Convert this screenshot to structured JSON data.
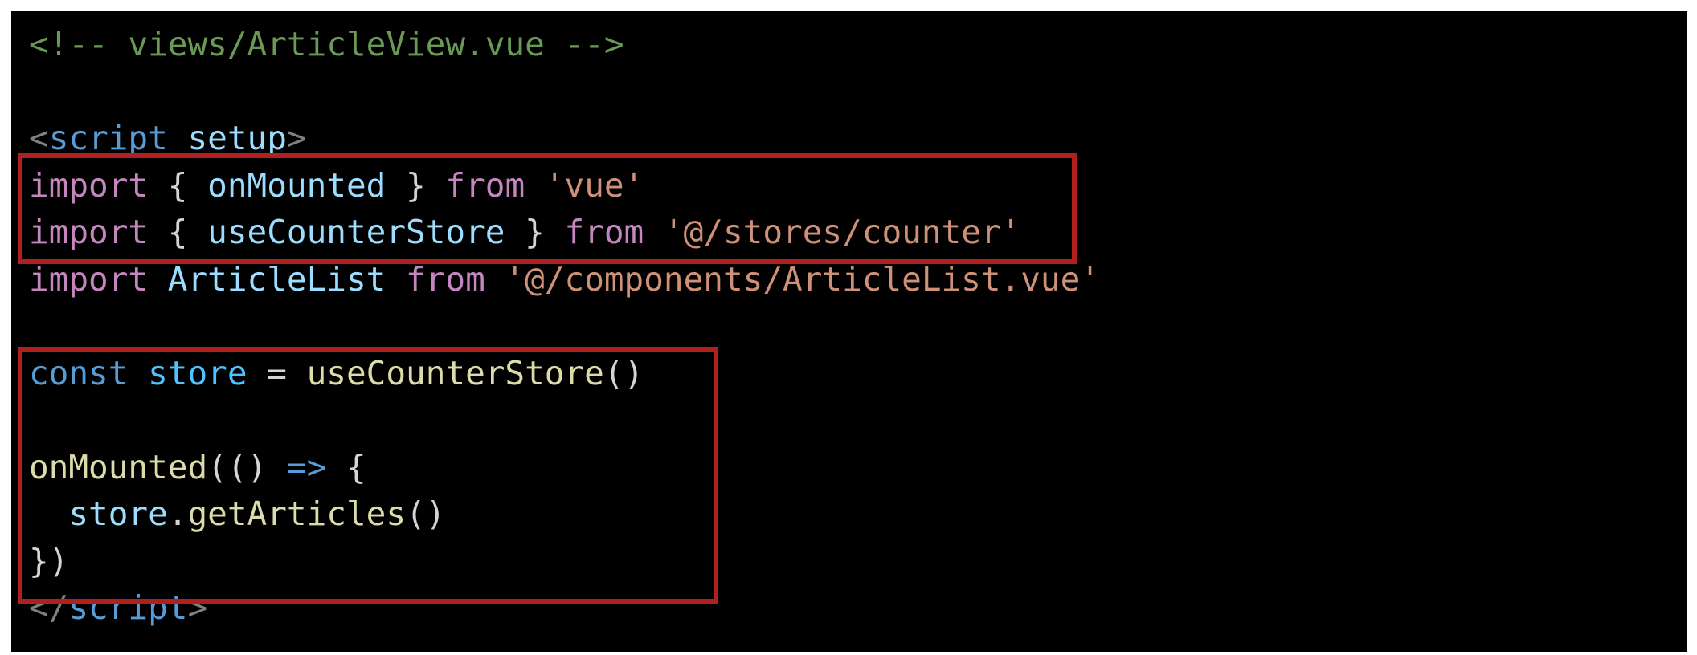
{
  "colors": {
    "background": "#000000",
    "page_border": "#ffffff",
    "highlight_box": "#b11f1f",
    "comment": "#6a9955",
    "keyword": "#c586c0",
    "string": "#ce9178",
    "function": "#dcdcaa",
    "variable": "#9cdcfe",
    "storage": "#569cd6",
    "constant": "#4fc1ff"
  },
  "code": {
    "lines": [
      [
        {
          "t": "<!-- views/ArticleView.vue -->",
          "c": "comment"
        }
      ],
      [],
      [
        {
          "t": "<",
          "c": "tag"
        },
        {
          "t": "script",
          "c": "tagname"
        },
        {
          "t": " ",
          "c": "punct"
        },
        {
          "t": "setup",
          "c": "attr"
        },
        {
          "t": ">",
          "c": "tag"
        }
      ],
      [
        {
          "t": "import",
          "c": "keyword"
        },
        {
          "t": " { ",
          "c": "punct"
        },
        {
          "t": "onMounted",
          "c": "var"
        },
        {
          "t": " } ",
          "c": "punct"
        },
        {
          "t": "from",
          "c": "keyword"
        },
        {
          "t": " ",
          "c": "punct"
        },
        {
          "t": "'vue'",
          "c": "string"
        }
      ],
      [
        {
          "t": "import",
          "c": "keyword"
        },
        {
          "t": " { ",
          "c": "punct"
        },
        {
          "t": "useCounterStore",
          "c": "var"
        },
        {
          "t": " } ",
          "c": "punct"
        },
        {
          "t": "from",
          "c": "keyword"
        },
        {
          "t": " ",
          "c": "punct"
        },
        {
          "t": "'@/stores/counter'",
          "c": "string"
        }
      ],
      [
        {
          "t": "import",
          "c": "keyword"
        },
        {
          "t": " ",
          "c": "punct"
        },
        {
          "t": "ArticleList",
          "c": "var"
        },
        {
          "t": " ",
          "c": "punct"
        },
        {
          "t": "from",
          "c": "keyword"
        },
        {
          "t": " ",
          "c": "punct"
        },
        {
          "t": "'@/components/ArticleList.vue'",
          "c": "string"
        }
      ],
      [],
      [
        {
          "t": "const",
          "c": "storage"
        },
        {
          "t": " ",
          "c": "punct"
        },
        {
          "t": "store",
          "c": "const"
        },
        {
          "t": " = ",
          "c": "op"
        },
        {
          "t": "useCounterStore",
          "c": "fn"
        },
        {
          "t": "()",
          "c": "punct"
        }
      ],
      [],
      [
        {
          "t": "onMounted",
          "c": "fn"
        },
        {
          "t": "(() ",
          "c": "punct"
        },
        {
          "t": "=>",
          "c": "arrow"
        },
        {
          "t": " {",
          "c": "punct"
        }
      ],
      [
        {
          "t": "  ",
          "c": "punct"
        },
        {
          "t": "store",
          "c": "var"
        },
        {
          "t": ".",
          "c": "punct"
        },
        {
          "t": "getArticles",
          "c": "fn"
        },
        {
          "t": "()",
          "c": "punct"
        }
      ],
      [
        {
          "t": "})",
          "c": "punct"
        }
      ],
      [
        {
          "t": "</",
          "c": "tag"
        },
        {
          "t": "script",
          "c": "tagname"
        },
        {
          "t": ">",
          "c": "tag"
        }
      ]
    ]
  }
}
